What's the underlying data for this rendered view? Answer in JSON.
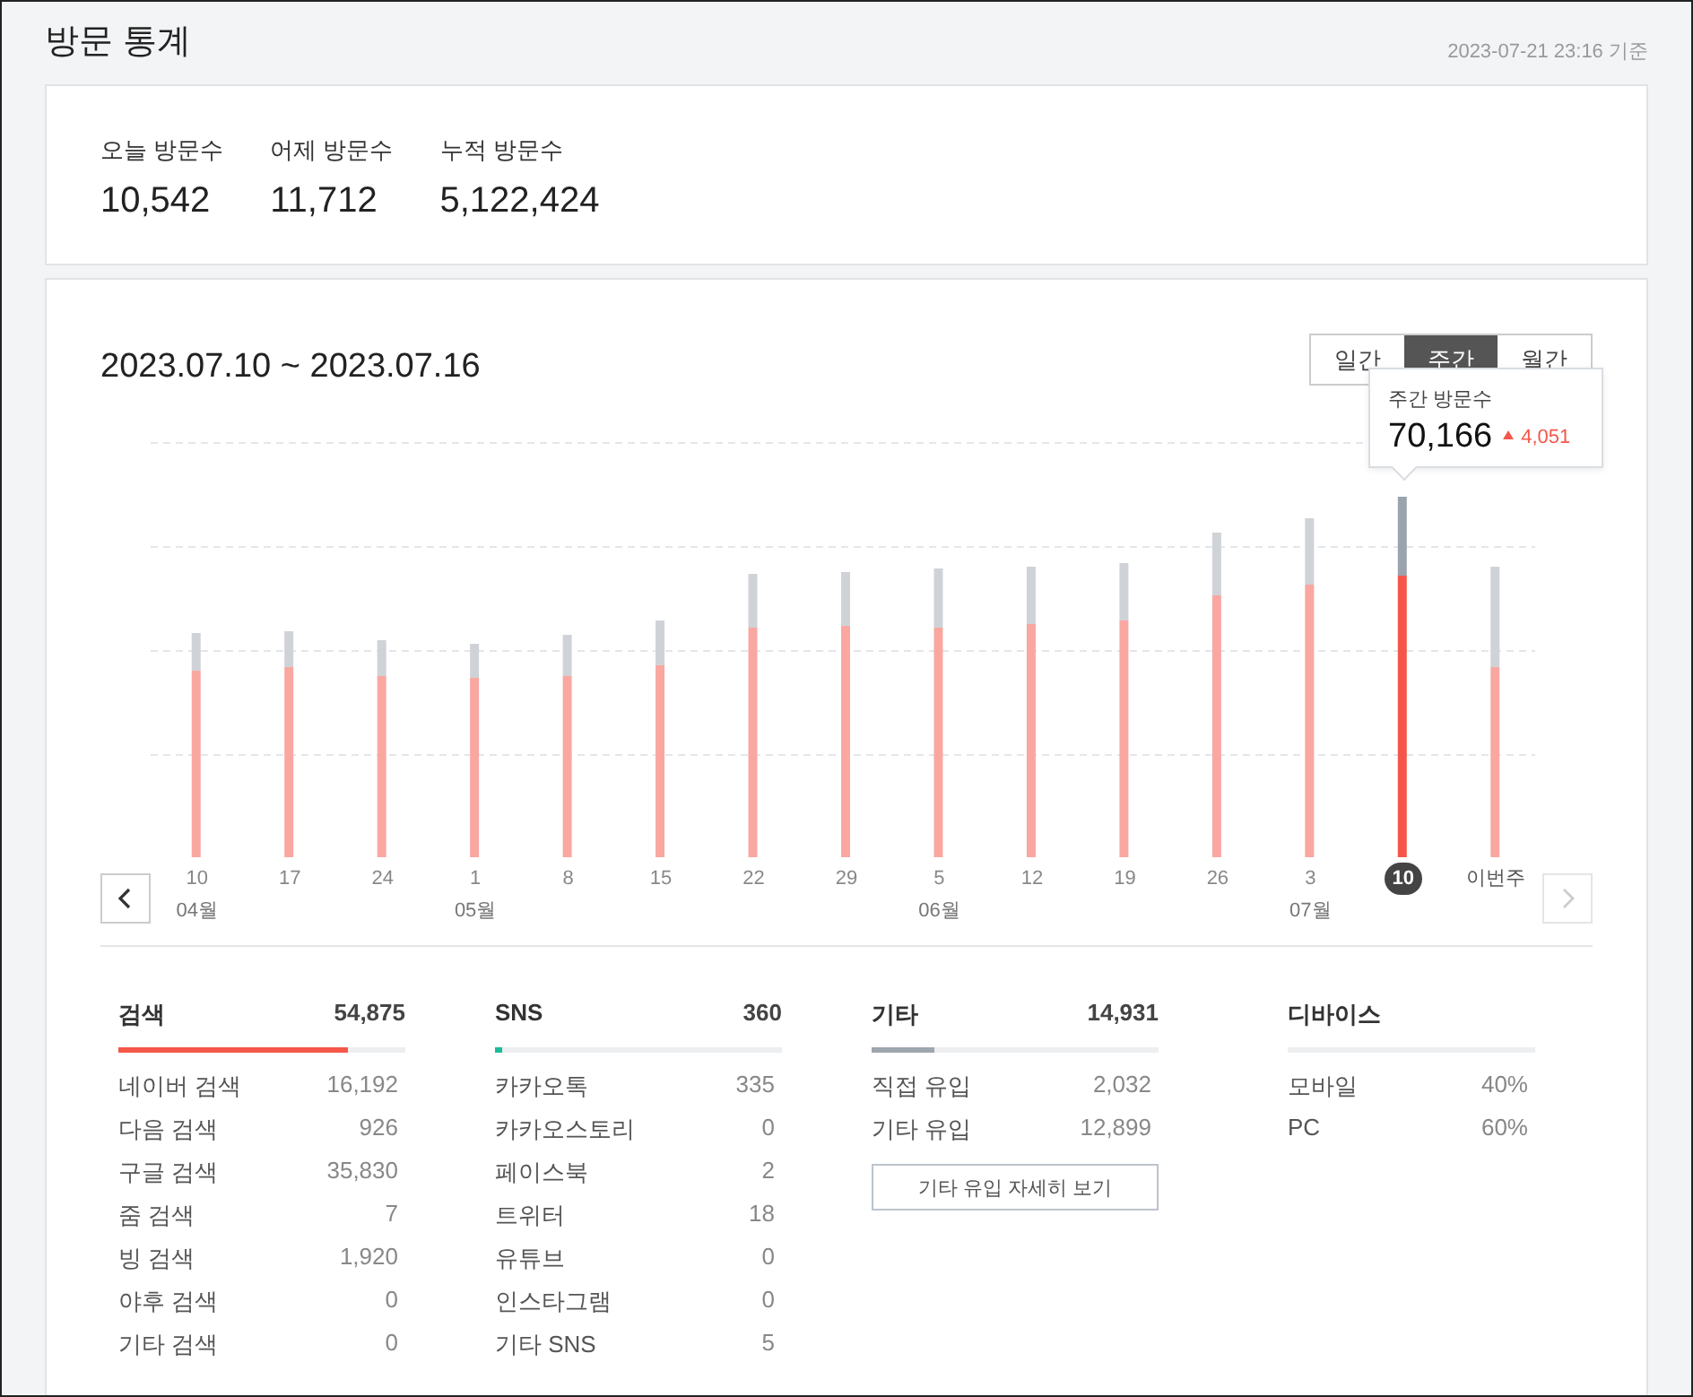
{
  "page": {
    "title": "방문 통계",
    "timestamp": "2023-07-21 23:16 기준"
  },
  "summary": [
    {
      "label": "오늘 방문수",
      "value": "10,542"
    },
    {
      "label": "어제 방문수",
      "value": "11,712"
    },
    {
      "label": "누적 방문수",
      "value": "5,122,424"
    }
  ],
  "chart_panel": {
    "range": "2023.07.10 ~ 2023.07.16",
    "periods": [
      {
        "label": "일간",
        "selected": false
      },
      {
        "label": "주간",
        "selected": true
      },
      {
        "label": "월간",
        "selected": false
      }
    ],
    "tooltip": {
      "label": "주간 방문수",
      "value": "70,166",
      "change": "4,051"
    },
    "weeks": [
      {
        "label": "10",
        "month": "04월",
        "selected": false
      },
      {
        "label": "17",
        "selected": false
      },
      {
        "label": "24",
        "selected": false
      },
      {
        "label": "1",
        "month": "05월",
        "selected": false
      },
      {
        "label": "8",
        "selected": false
      },
      {
        "label": "15",
        "selected": false
      },
      {
        "label": "22",
        "selected": false
      },
      {
        "label": "29",
        "selected": false
      },
      {
        "label": "5",
        "month": "06월",
        "selected": false
      },
      {
        "label": "12",
        "selected": false
      },
      {
        "label": "19",
        "selected": false
      },
      {
        "label": "26",
        "selected": false
      },
      {
        "label": "3",
        "month": "07월",
        "selected": false
      },
      {
        "label": "10",
        "selected": true
      },
      {
        "label": "이번주",
        "selected": false
      }
    ]
  },
  "sections": [
    {
      "title": "검색",
      "total": "54,875",
      "level": 0.8,
      "color": "#f4574a",
      "rows": [
        {
          "label": "네이버 검색",
          "value": "16,192"
        },
        {
          "label": "다음 검색",
          "value": "926"
        },
        {
          "label": "구글 검색",
          "value": "35,830"
        },
        {
          "label": "줌 검색",
          "value": "7"
        },
        {
          "label": "빙 검색",
          "value": "1,920"
        },
        {
          "label": "야후 검색",
          "value": "0"
        },
        {
          "label": "기타 검색",
          "value": "0"
        }
      ]
    },
    {
      "title": "SNS",
      "total": "360",
      "level": 0.025,
      "color": "#1abc9c",
      "rows": [
        {
          "label": "카카오톡",
          "value": "335"
        },
        {
          "label": "카카오스토리",
          "value": "0"
        },
        {
          "label": "페이스북",
          "value": "2"
        },
        {
          "label": "트위터",
          "value": "18"
        },
        {
          "label": "유튜브",
          "value": "0"
        },
        {
          "label": "인스타그램",
          "value": "0"
        },
        {
          "label": "기타 SNS",
          "value": "5"
        }
      ]
    },
    {
      "title": "기타",
      "total": "14,931",
      "level": 0.22,
      "color": "#9ea5ad",
      "rows": [
        {
          "label": "직접 유입",
          "value": "2,032"
        },
        {
          "label": "기타 유입",
          "value": "12,899"
        }
      ],
      "button": "기타 유입 자세히 보기"
    },
    {
      "title": "디바이스",
      "rows": [
        {
          "label": "모바일",
          "value": "40%"
        },
        {
          "label": "PC",
          "value": "60%"
        }
      ]
    }
  ]
}
